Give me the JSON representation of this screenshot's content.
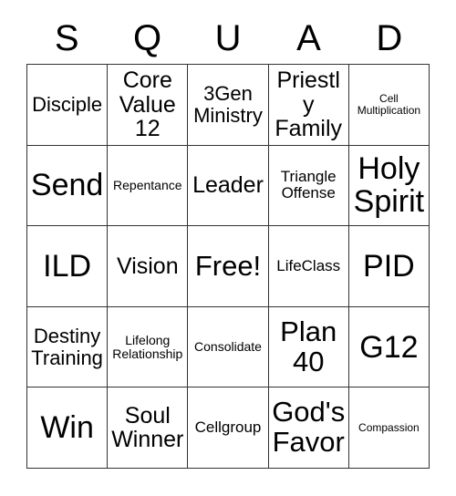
{
  "card": {
    "title_letters": [
      "S",
      "Q",
      "U",
      "A",
      "D"
    ],
    "columns": 5,
    "rows": 5,
    "background_color": "#ffffff",
    "border_color": "#333333",
    "text_color": "#000000",
    "free_space_label": "Free!",
    "cells": [
      [
        {
          "label": "Disciple",
          "size": "s-sm"
        },
        {
          "label": "Core Value 12",
          "size": "s-md"
        },
        {
          "label": "3Gen Ministry",
          "size": "s-sm"
        },
        {
          "label": "Priestly Family",
          "size": "s-md"
        },
        {
          "label": "Cell Multiplication",
          "size": "s-tiny"
        }
      ],
      [
        {
          "label": "Send",
          "size": "s-xl"
        },
        {
          "label": "Repentance",
          "size": "s-xxs"
        },
        {
          "label": "Leader",
          "size": "s-md"
        },
        {
          "label": "Triangle Offense",
          "size": "s-xs"
        },
        {
          "label": "Holy Spirit",
          "size": "s-xl"
        }
      ],
      [
        {
          "label": "ILD",
          "size": "s-xl"
        },
        {
          "label": "Vision",
          "size": "s-md"
        },
        {
          "label": "Free!",
          "size": "s-lg"
        },
        {
          "label": "LifeClass",
          "size": "s-xs"
        },
        {
          "label": "PID",
          "size": "s-xl"
        }
      ],
      [
        {
          "label": "Destiny Training",
          "size": "s-sm"
        },
        {
          "label": "Lifelong Relationship",
          "size": "s-xxs"
        },
        {
          "label": "Consolidate",
          "size": "s-xxs"
        },
        {
          "label": "Plan 40",
          "size": "s-lg"
        },
        {
          "label": "G12",
          "size": "s-xl"
        }
      ],
      [
        {
          "label": "Win",
          "size": "s-xl"
        },
        {
          "label": "Soul Winner",
          "size": "s-md"
        },
        {
          "label": "Cellgroup",
          "size": "s-xs"
        },
        {
          "label": "God's Favor",
          "size": "s-lg"
        },
        {
          "label": "Compassion",
          "size": "s-tiny"
        }
      ]
    ]
  }
}
